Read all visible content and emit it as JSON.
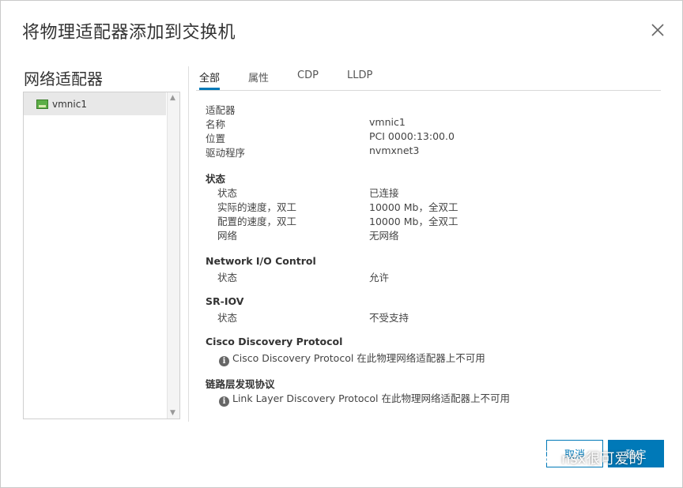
{
  "dialog": {
    "title": "将物理适配器添加到交换机",
    "close_icon": "close-icon"
  },
  "left": {
    "title": "网络适配器",
    "items": [
      {
        "label": "vmnic1",
        "icon": "network-card-icon"
      }
    ]
  },
  "tabs": [
    "全部",
    "属性",
    "CDP",
    "LLDP"
  ],
  "active_tab": "全部",
  "details": {
    "adapter": {
      "heading": "适配器",
      "rows": [
        {
          "label": "名称",
          "value": "vmnic1"
        },
        {
          "label": "位置",
          "value": "PCI 0000:13:00.0"
        },
        {
          "label": "驱动程序",
          "value": "nvmxnet3"
        }
      ]
    },
    "status": {
      "heading": "状态",
      "rows": [
        {
          "label": "状态",
          "value": "已连接"
        },
        {
          "label": "实际的速度，双工",
          "value": "10000 Mb，全双工"
        },
        {
          "label": "配置的速度，双工",
          "value": "10000 Mb，全双工"
        },
        {
          "label": "网络",
          "value": "无网络"
        }
      ]
    },
    "nioc": {
      "heading": "Network I/O Control",
      "rows": [
        {
          "label": "状态",
          "value": "允许"
        }
      ]
    },
    "sriov": {
      "heading": "SR-IOV",
      "rows": [
        {
          "label": "状态",
          "value": "不受支持"
        }
      ]
    },
    "cdp": {
      "heading": "Cisco Discovery Protocol",
      "message": "Cisco Discovery Protocol 在此物理网络适配器上不可用"
    },
    "lldp": {
      "heading": "链路层发现协议",
      "message": "Link Layer Discovery Protocol 在此物理网络适配器上不可用"
    }
  },
  "buttons": {
    "cancel": "取消",
    "ok": "确定"
  },
  "watermark": "nsx很可爱的",
  "colors": {
    "accent": "#0079b8",
    "nic_green": "#5cae46"
  }
}
